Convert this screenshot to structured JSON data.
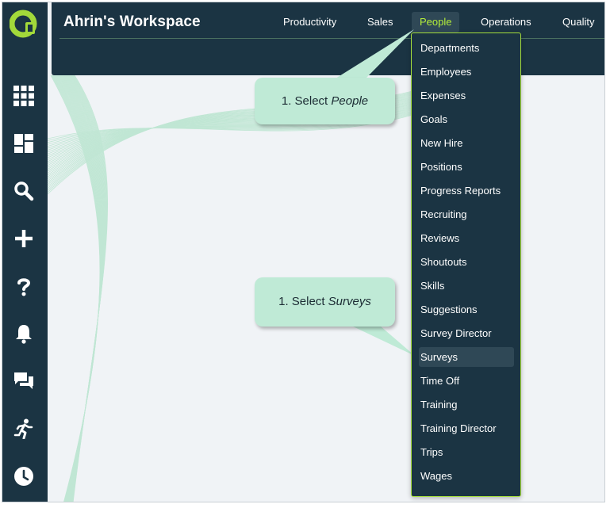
{
  "window": {
    "title": "Ahrin's Workspace"
  },
  "nav": {
    "tabs": [
      {
        "label": "Productivity"
      },
      {
        "label": "Sales"
      },
      {
        "label": "People"
      },
      {
        "label": "Operations"
      },
      {
        "label": "Quality"
      }
    ],
    "active": "People"
  },
  "sidebar": {
    "icons": [
      "app-logo-icon",
      "apps-grid-icon",
      "dashboard-icon",
      "search-icon",
      "add-icon",
      "help-icon",
      "notifications-bell-icon",
      "chat-icon",
      "activity-runner-icon",
      "history-clock-icon"
    ]
  },
  "dropdown": {
    "items": [
      {
        "label": "Departments"
      },
      {
        "label": "Employees"
      },
      {
        "label": "Expenses"
      },
      {
        "label": "Goals"
      },
      {
        "label": "New Hire"
      },
      {
        "label": "Positions"
      },
      {
        "label": "Progress Reports"
      },
      {
        "label": "Recruiting"
      },
      {
        "label": "Reviews"
      },
      {
        "label": "Shoutouts"
      },
      {
        "label": "Skills"
      },
      {
        "label": "Suggestions"
      },
      {
        "label": "Survey Director"
      },
      {
        "label": "Surveys"
      },
      {
        "label": "Time Off"
      },
      {
        "label": "Training"
      },
      {
        "label": "Training Director"
      },
      {
        "label": "Trips"
      },
      {
        "label": "Wages"
      }
    ],
    "highlighted": "Surveys"
  },
  "callouts": [
    {
      "prefix": "1. Select ",
      "emphasis": "People"
    },
    {
      "prefix": "1. Select ",
      "emphasis": "Surveys"
    }
  ],
  "colors": {
    "navy": "#1b3443",
    "accent": "#b6f03a",
    "callout": "#bfead6",
    "background": "#f0f3f6"
  }
}
